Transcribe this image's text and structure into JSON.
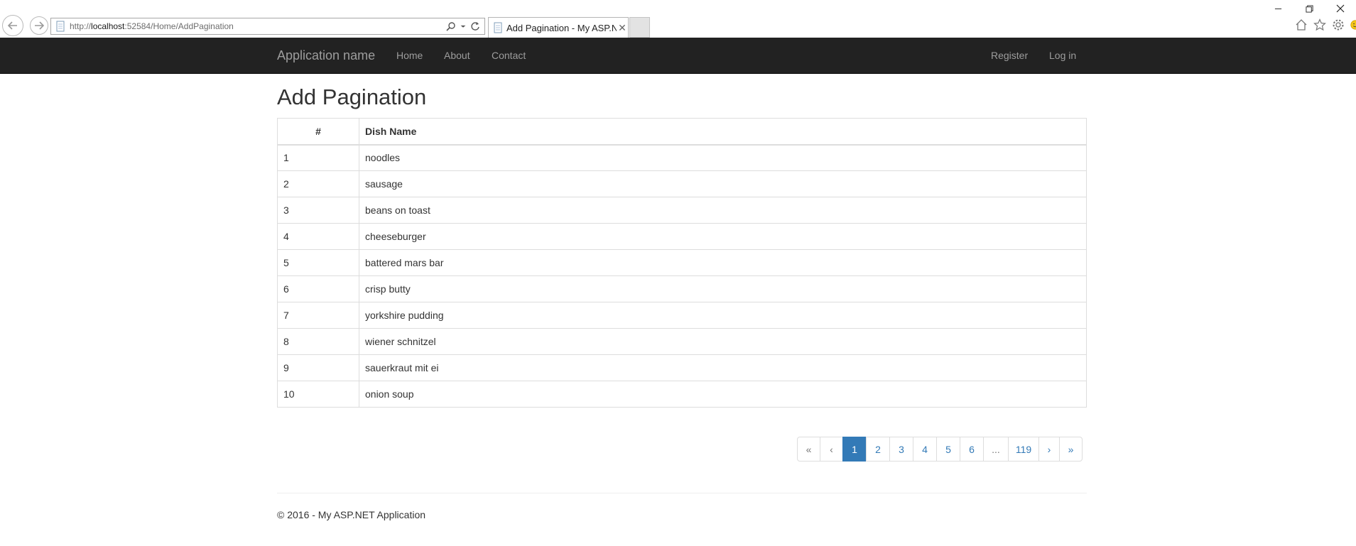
{
  "browser": {
    "url_prefix": "http://",
    "url_host": "localhost",
    "url_rest": ":52584/Home/AddPagination",
    "tab_title": "Add Pagination - My ASP.N...",
    "tab_close": "✕"
  },
  "navbar": {
    "brand": "Application name",
    "links": [
      "Home",
      "About",
      "Contact"
    ],
    "right_links": [
      "Register",
      "Log in"
    ]
  },
  "page": {
    "title": "Add Pagination"
  },
  "table": {
    "headers": [
      "#",
      "Dish Name"
    ],
    "rows": [
      [
        "1",
        "noodles"
      ],
      [
        "2",
        "sausage"
      ],
      [
        "3",
        "beans on toast"
      ],
      [
        "4",
        "cheeseburger"
      ],
      [
        "5",
        "battered mars bar"
      ],
      [
        "6",
        "crisp butty"
      ],
      [
        "7",
        "yorkshire pudding"
      ],
      [
        "8",
        "wiener schnitzel"
      ],
      [
        "9",
        "sauerkraut mit ei"
      ],
      [
        "10",
        "onion soup"
      ]
    ]
  },
  "pagination": {
    "items": [
      {
        "label": "«",
        "state": "disabled"
      },
      {
        "label": "‹",
        "state": "disabled"
      },
      {
        "label": "1",
        "state": "active"
      },
      {
        "label": "2",
        "state": "normal"
      },
      {
        "label": "3",
        "state": "normal"
      },
      {
        "label": "4",
        "state": "normal"
      },
      {
        "label": "5",
        "state": "normal"
      },
      {
        "label": "6",
        "state": "normal"
      },
      {
        "label": "...",
        "state": "disabled"
      },
      {
        "label": "119",
        "state": "normal"
      },
      {
        "label": "›",
        "state": "normal"
      },
      {
        "label": "»",
        "state": "normal"
      }
    ]
  },
  "footer": {
    "text": "© 2016 - My ASP.NET Application"
  },
  "colors": {
    "navbar_bg": "#222222",
    "link": "#337ab7",
    "active": "#337ab7"
  }
}
